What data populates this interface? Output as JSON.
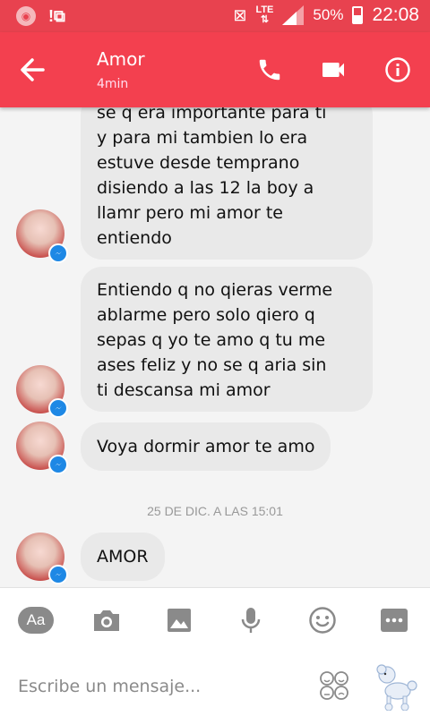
{
  "status": {
    "network": "LTE",
    "battery": "50%",
    "battery_level": 0.5,
    "time": "22:08"
  },
  "header": {
    "title": "Amor",
    "subtitle": "4min"
  },
  "messages": [
    {
      "lines": [
        "se q era importante para ti",
        "y para mi tambien lo era",
        "estuve desde temprano",
        "disiendo a las 12 la boy a",
        "llamr pero mi amor te",
        "entiendo"
      ]
    },
    {
      "lines": [
        "Entiendo q no qieras verme",
        "ablarme pero solo qiero q",
        "sepas q yo te amo q tu me",
        "ases feliz y no se q aria sin",
        "ti descansa mi amor"
      ]
    },
    {
      "lines": [
        "Voya dormir amor te amo"
      ]
    },
    {
      "lines": [
        "AMOR"
      ]
    }
  ],
  "timestamp": "25 DE DIC. A LAS 15:01",
  "toolbar": {
    "font_label": "Aa",
    "icons": [
      "font-icon",
      "camera-icon",
      "image-icon",
      "microphone-icon",
      "smiley-icon",
      "more-icon"
    ]
  },
  "composer": {
    "placeholder": "Escribe un mensaje..."
  },
  "colors": {
    "accent": "#f3404f",
    "bubble": "#e9e9e9",
    "messenger_badge": "#1e88e5"
  }
}
